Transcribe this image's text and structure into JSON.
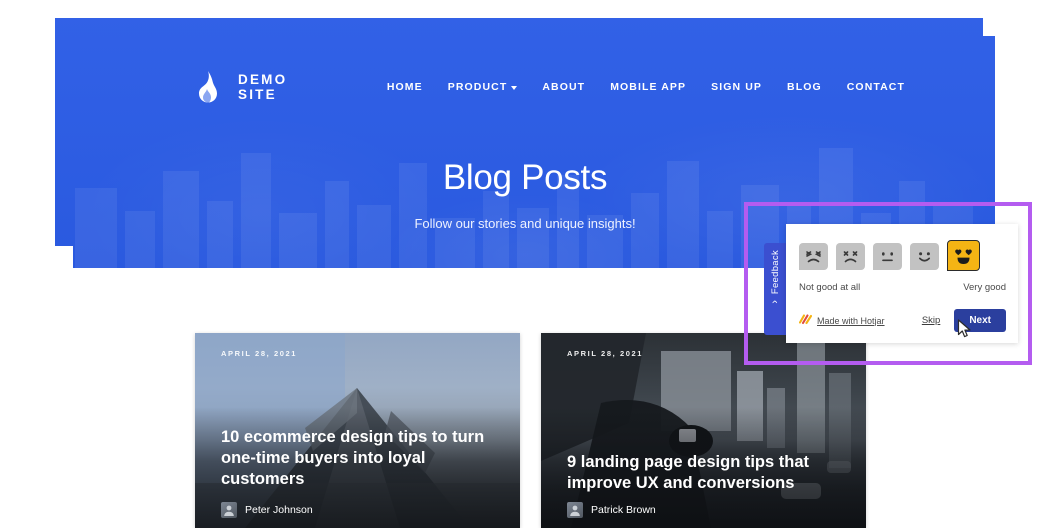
{
  "site": {
    "brand_name": "DEMO SITE",
    "logo_icon": "flame-icon",
    "nav": [
      {
        "label": "HOME",
        "has_dropdown": false
      },
      {
        "label": "PRODUCT",
        "has_dropdown": true
      },
      {
        "label": "ABOUT",
        "has_dropdown": false
      },
      {
        "label": "MOBILE APP",
        "has_dropdown": false
      },
      {
        "label": "SIGN UP",
        "has_dropdown": false
      },
      {
        "label": "BLOG",
        "has_dropdown": false
      },
      {
        "label": "CONTACT",
        "has_dropdown": false
      }
    ],
    "hero": {
      "title": "Blog Posts",
      "subtitle": "Follow our stories and unique insights!",
      "background_color": "#2b5ce6"
    }
  },
  "blog_cards": [
    {
      "date": "APRIL 28, 2021",
      "title": "10 ecommerce design tips to turn one-time buyers into loyal customers",
      "author": "Peter Johnson",
      "avatar_icon": "user-avatar"
    },
    {
      "date": "APRIL 28, 2021",
      "title": "9 landing page design tips that improve UX and conversions",
      "author": "Patrick Brown",
      "avatar_icon": "user-avatar"
    }
  ],
  "feedback_widget": {
    "tab_label": "Feedback",
    "tab_chevron_icon": "chevron-right-icon",
    "ratings": [
      {
        "name": "angry-face-icon",
        "label": "angry",
        "selected": false
      },
      {
        "name": "sad-face-icon",
        "label": "sad",
        "selected": false
      },
      {
        "name": "neutral-face-icon",
        "label": "neutral",
        "selected": false
      },
      {
        "name": "smile-face-icon",
        "label": "smile",
        "selected": false
      },
      {
        "name": "heart-eyes-face-icon",
        "label": "very happy",
        "selected": true
      }
    ],
    "scale_low_label": "Not good at all",
    "scale_high_label": "Very good",
    "made_with_label": "Made with Hotjar",
    "made_with_icon": "hotjar-logo-icon",
    "skip_label": "Skip",
    "next_label": "Next",
    "next_button_color": "#2b3f9e",
    "selected_color": "#f5b414"
  },
  "annotation": {
    "highlight_color": "#b45cf0",
    "cursor_icon": "mouse-pointer-icon"
  }
}
